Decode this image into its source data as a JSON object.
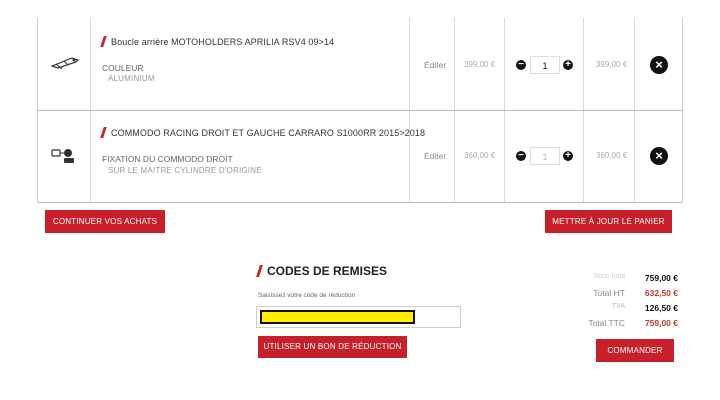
{
  "cart": {
    "items": [
      {
        "name": "Boucle arrière MOTOHOLDERS APRILIA RSV4 09>14",
        "option_label": "COULEUR",
        "option_value": "ALUMINIUM",
        "edit_label": "Éditer",
        "unit_price": "399,00 €",
        "quantity": "1",
        "total": "399,00 €",
        "thumb_icon": "exhaust-bracket-icon"
      },
      {
        "name": "COMMODO RACING DROIT ET GAUCHE CARRARO S1000RR 2015>2018",
        "option_label": "FIXATION DU COMMODO DROIT",
        "option_value": "SUR LE MAITRE CYLINDRE D'ORIGINE",
        "edit_label": "Éditer",
        "unit_price": "360,00 €",
        "quantity": "1",
        "total": "360,00 €",
        "thumb_icon": "switch-controls-icon"
      }
    ],
    "continue_label": "CONTINUER VOS ACHATS",
    "update_label": "METTRE À JOUR LE PANIER"
  },
  "discount": {
    "title": "CODES DE REMISES",
    "field_label": "Saisissez votre code de réduction",
    "input_value": "",
    "apply_label": "UTILISER UN BON DE RÉDUCTION"
  },
  "summary": {
    "subtotal_label": "Sous-total",
    "subtotal_value": "759,00 €",
    "ht_label": "Total HT",
    "ht_value": "632,50 €",
    "tva_label": "TVA",
    "tva_value": "126,50 €",
    "ttc_label": "Total TTC",
    "ttc_value": "759,00 €",
    "order_label": "COMMANDER"
  },
  "colors": {
    "accent": "#c8202a",
    "highlight": "#ffee00",
    "price_highlight": "#c0392b"
  }
}
